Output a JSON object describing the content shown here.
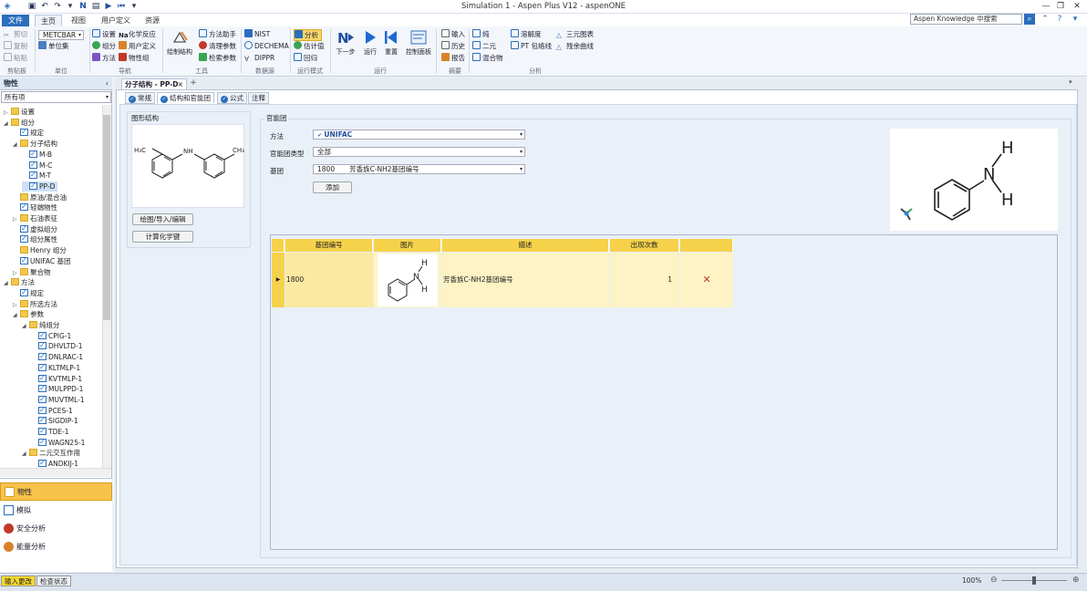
{
  "window": {
    "title": "Simulation 1 - Aspen Plus V12 - aspenONE"
  },
  "menu": {
    "file": "文件",
    "home": "主页",
    "view": "视图",
    "customize": "用户定义",
    "resources": "资源"
  },
  "search": {
    "placeholder": "Aspen Knowledge 中搜索"
  },
  "ribbon": {
    "clipboard": {
      "cut": "剪切",
      "copy": "复制",
      "paste": "粘贴",
      "label": "剪贴板"
    },
    "units": {
      "unitset": "METCBAR",
      "unitsets": "单位集",
      "label": "单位"
    },
    "navigate": {
      "setup": "设置",
      "components": "组分",
      "methods": "方法",
      "chemistry": "化学反应",
      "customize": "用户定义",
      "propsets": "物性组",
      "label": "导航"
    },
    "tools": {
      "draw": "绘制结构",
      "methods_assist": "方法助手",
      "clean_params": "清理参数",
      "retrieve_params": "检索参数",
      "label": "工具"
    },
    "data_source": {
      "nist": "NIST",
      "dechema": "DECHEMA",
      "dippr": "DIPPR",
      "label": "数据源"
    },
    "run_mode": {
      "analysis": "分析",
      "estimation": "估计值",
      "regression": "回归",
      "label": "运行模式"
    },
    "run": {
      "next": "下一步",
      "run": "运行",
      "reset": "重置",
      "control_panel": "控制面板",
      "label": "运行"
    },
    "summary": {
      "input": "输入",
      "history": "历史",
      "report": "报告",
      "label": "摘要"
    },
    "analysis": {
      "pure": "纯",
      "binary": "二元",
      "mixture": "混合物",
      "solubility": "溶解度",
      "pt_envelope": "PT 包络线",
      "ternary": "三元图表",
      "residue": "残余曲线",
      "label": "分析"
    }
  },
  "left_pane": {
    "header": "物性",
    "filter": "所有项",
    "tree": [
      {
        "label": "设置",
        "indent": 0,
        "icon": "folder",
        "twist": "▷"
      },
      {
        "label": "组分",
        "indent": 0,
        "icon": "folder",
        "twist": "◢"
      },
      {
        "label": "规定",
        "indent": 1,
        "icon": "check",
        "twist": ""
      },
      {
        "label": "分子结构",
        "indent": 1,
        "icon": "folder",
        "twist": "◢"
      },
      {
        "label": "M-B",
        "indent": 2,
        "icon": "check",
        "twist": ""
      },
      {
        "label": "M-C",
        "indent": 2,
        "icon": "check",
        "twist": ""
      },
      {
        "label": "M-T",
        "indent": 2,
        "icon": "check",
        "twist": ""
      },
      {
        "label": "PP-D",
        "indent": 2,
        "icon": "check",
        "twist": "",
        "selected": true
      },
      {
        "label": "原油/混合油",
        "indent": 1,
        "icon": "folder",
        "twist": ""
      },
      {
        "label": "轻端物性",
        "indent": 1,
        "icon": "check",
        "twist": ""
      },
      {
        "label": "石油表征",
        "indent": 1,
        "icon": "folder",
        "twist": "▷"
      },
      {
        "label": "虚拟组分",
        "indent": 1,
        "icon": "check",
        "twist": ""
      },
      {
        "label": "组分属性",
        "indent": 1,
        "icon": "check",
        "twist": ""
      },
      {
        "label": "Henry 组分",
        "indent": 1,
        "icon": "folder",
        "twist": ""
      },
      {
        "label": "UNIFAC 基团",
        "indent": 1,
        "icon": "check",
        "twist": ""
      },
      {
        "label": "聚合物",
        "indent": 1,
        "icon": "folder",
        "twist": "▷"
      },
      {
        "label": "方法",
        "indent": 0,
        "icon": "folder",
        "twist": "◢"
      },
      {
        "label": "规定",
        "indent": 1,
        "icon": "check",
        "twist": ""
      },
      {
        "label": "所选方法",
        "indent": 1,
        "icon": "folder",
        "twist": "▷"
      },
      {
        "label": "参数",
        "indent": 1,
        "icon": "folder",
        "twist": "◢"
      },
      {
        "label": "纯组分",
        "indent": 2,
        "icon": "folder",
        "twist": "◢"
      },
      {
        "label": "CPIG-1",
        "indent": 3,
        "icon": "check",
        "twist": ""
      },
      {
        "label": "DHVLTD-1",
        "indent": 3,
        "icon": "check",
        "twist": ""
      },
      {
        "label": "DNLRAC-1",
        "indent": 3,
        "icon": "check",
        "twist": ""
      },
      {
        "label": "KLTMLP-1",
        "indent": 3,
        "icon": "check",
        "twist": ""
      },
      {
        "label": "KVTMLP-1",
        "indent": 3,
        "icon": "check",
        "twist": ""
      },
      {
        "label": "MULPPD-1",
        "indent": 3,
        "icon": "check",
        "twist": ""
      },
      {
        "label": "MUVTML-1",
        "indent": 3,
        "icon": "check",
        "twist": ""
      },
      {
        "label": "PCES-1",
        "indent": 3,
        "icon": "check",
        "twist": ""
      },
      {
        "label": "SIGDIP-1",
        "indent": 3,
        "icon": "check",
        "twist": ""
      },
      {
        "label": "TDE-1",
        "indent": 3,
        "icon": "check",
        "twist": ""
      },
      {
        "label": "WAGN25-1",
        "indent": 3,
        "icon": "check",
        "twist": ""
      },
      {
        "label": "二元交互作用",
        "indent": 2,
        "icon": "folder",
        "twist": "◢"
      },
      {
        "label": "ANDKIJ-1",
        "indent": 3,
        "icon": "check",
        "twist": ""
      }
    ],
    "nav": {
      "properties": "物性",
      "simulation": "模拟",
      "safety": "安全分析",
      "energy": "能量分析"
    }
  },
  "doc_tab": {
    "title": "分子结构 - PP-D"
  },
  "sub_tabs": {
    "general": "常规",
    "structure": "结构和官能团",
    "formula": "公式",
    "comments": "注释"
  },
  "structure_panel": {
    "label": "图形结构",
    "draw_button": "绘图/导入/编辑",
    "calc_button": "计算化学键"
  },
  "functional_groups": {
    "label": "官能团",
    "method_label": "方法",
    "method_value": "UNIFAC",
    "group_type_label": "官能团类型",
    "group_type_value": "全部",
    "group_label": "基团",
    "group_number": "1800",
    "group_desc": "芳香族C-NH2基团编号",
    "add_button": "添加"
  },
  "grid": {
    "headers": [
      "基团编号",
      "图片",
      "描述",
      "出现次数"
    ],
    "rows": [
      {
        "number": "1800",
        "description": "芳香族C-NH2基团编号",
        "count": "1"
      }
    ]
  },
  "status": {
    "input_changed": "输入更改",
    "check_status": "检查状态",
    "zoom": "100%"
  },
  "molecule_labels": {
    "ch3_left": "H₃C",
    "nh": "NH",
    "ch3_right": "CH₃",
    "n": "N",
    "h": "H"
  }
}
